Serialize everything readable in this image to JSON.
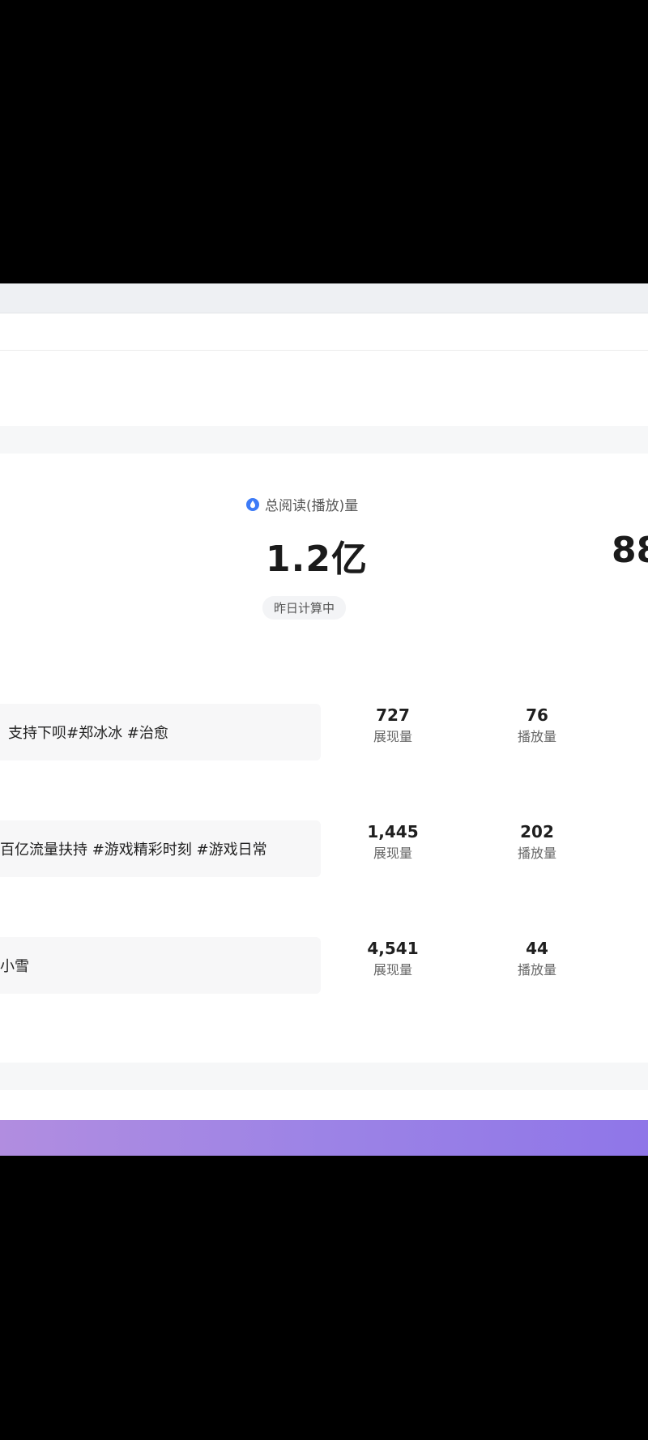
{
  "stats": {
    "label": "总阅读(播放)量",
    "value": "1.2亿",
    "value_partial": "88",
    "status": "昨日计算中",
    "icon": "blue-droplet-icon",
    "accent_color": "#3d7bf7"
  },
  "rows": [
    {
      "title": "支持下呗#郑冰冰 #治愈",
      "impressions": "727",
      "impressions_label": "展现量",
      "plays": "76",
      "plays_label": "播放量"
    },
    {
      "title": "百亿流量扶持 #游戏精彩时刻 #游戏日常",
      "impressions": "1,445",
      "impressions_label": "展现量",
      "plays": "202",
      "plays_label": "播放量"
    },
    {
      "title": "小雪",
      "impressions": "4,541",
      "impressions_label": "展现量",
      "plays": "44",
      "plays_label": "播放量"
    }
  ]
}
